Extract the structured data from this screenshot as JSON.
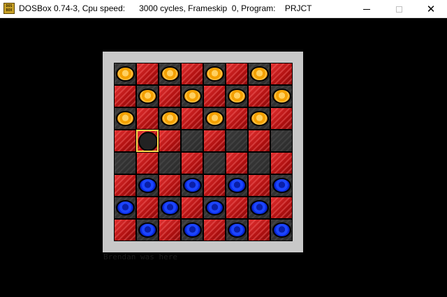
{
  "window": {
    "title": "DOSBox 0.74-3, Cpu speed:      3000 cycles, Frameskip  0, Program:    PRJCT",
    "icon_label": "DOS BOX",
    "minimize_icon": "minimize-icon",
    "maximize_icon": "maximize-icon",
    "close_icon": "close-icon",
    "close_glyph": "✕"
  },
  "colors": {
    "red_square": "#c01818",
    "dark_square": "#2e2e2e",
    "orange_piece": "#f4a000",
    "blue_piece": "#1c45ff",
    "selection": "#ffd84a",
    "board_border": "#c8c8c8"
  },
  "board": {
    "rows": [
      [
        "O",
        "R",
        "O",
        "R",
        "O",
        "R",
        "O",
        "R"
      ],
      [
        "R",
        "O",
        "R",
        "O",
        "R",
        "O",
        "R",
        "O"
      ],
      [
        "O",
        "R",
        "O",
        "R",
        "O",
        "R",
        "O",
        "R"
      ],
      [
        "R",
        "X",
        "R",
        "D",
        "R",
        "D",
        "R",
        "D"
      ],
      [
        "D",
        "R",
        "D",
        "R",
        "D",
        "R",
        "D",
        "R"
      ],
      [
        "R",
        "B",
        "R",
        "B",
        "R",
        "B",
        "R",
        "B"
      ],
      [
        "B",
        "R",
        "B",
        "R",
        "B",
        "R",
        "B",
        "R"
      ],
      [
        "R",
        "B",
        "R",
        "B",
        "R",
        "B",
        "R",
        "B"
      ]
    ],
    "legend": {
      "O": "orange-piece-on-dark-square",
      "B": "blue-piece-on-dark-square",
      "R": "empty-red-square",
      "D": "empty-dark-square",
      "X": "selected-empty-square"
    },
    "selected": {
      "row": 3,
      "col": 1
    }
  },
  "caption": "Brendan was here"
}
